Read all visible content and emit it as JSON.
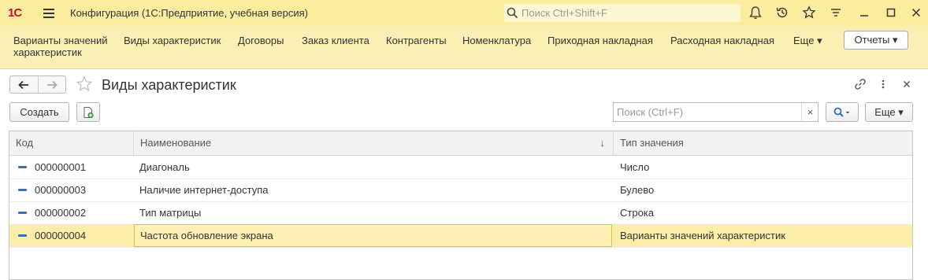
{
  "titlebar": {
    "logo": "1С",
    "title": "Конфигурация  (1С:Предприятие, учебная версия)",
    "search_placeholder": "Поиск Ctrl+Shift+F",
    "icons": [
      "bell-icon",
      "history-icon",
      "star-icon",
      "settings-lines-icon",
      "minimize-icon",
      "maximize-icon",
      "close-icon"
    ]
  },
  "sections": {
    "items": [
      {
        "label": "Варианты значений характеристик"
      },
      {
        "label": "Виды характеристик"
      },
      {
        "label": "Договоры"
      },
      {
        "label": "Заказ клиента"
      },
      {
        "label": "Контрагенты"
      },
      {
        "label": "Номенклатура"
      },
      {
        "label": "Приходная накладная"
      },
      {
        "label": "Расходная накладная"
      },
      {
        "label": "Еще ▾"
      }
    ],
    "reports_label": "Отчеты ▾"
  },
  "form": {
    "title": "Виды характеристик",
    "create_label": "Создать",
    "search_placeholder": "Поиск (Ctrl+F)",
    "clear_label": "×",
    "more_label": "Еще ▾"
  },
  "table": {
    "columns": [
      "Код",
      "Наименование",
      "Тип значения"
    ],
    "sort_indicator": "↓",
    "rows": [
      {
        "code": "000000001",
        "name": "Диагональ",
        "type": "Число"
      },
      {
        "code": "000000003",
        "name": "Наличие интернет-доступа",
        "type": "Булево"
      },
      {
        "code": "000000002",
        "name": "Тип матрицы",
        "type": "Строка"
      },
      {
        "code": "000000004",
        "name": "Частота обновление экрана",
        "type": "Варианты значений характеристик"
      }
    ],
    "selected_row": 3
  },
  "colors": {
    "titlebar_bg": "#fbed9e",
    "sections_bg": "#fbf0b4",
    "selected_row_bg": "#fbeeab",
    "logo": "#c8102e"
  }
}
